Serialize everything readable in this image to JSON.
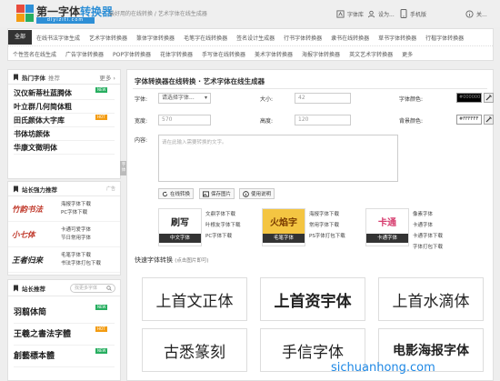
{
  "header": {
    "logo_title_prefix": "第一字体",
    "logo_title_suffix": "转换器",
    "logo_domain": "diyiziti.com",
    "slogan": "最好用的在线转换 / 艺术字体在线生成器",
    "links": [
      {
        "label": "字体库",
        "icon": "font-library-icon"
      },
      {
        "label": "设为...",
        "icon": "user-icon"
      },
      {
        "label": "手机版",
        "icon": "mobile-icon"
      },
      {
        "label": "关...",
        "icon": "info-icon"
      }
    ]
  },
  "nav": {
    "row1": [
      "全部",
      "在线书法字体生成",
      "艺术字体转换器",
      "篆体字体转换器",
      "毛笔字在线转换器",
      "签名设计生成器",
      "行书字体转换器",
      "隶书在线转换器",
      "草书字体转换器",
      "行楷字体转换器"
    ],
    "row2": [
      "个性签名在线生成",
      "广告字体转换器",
      "POP字体转换器",
      "花体字转换器",
      "手写体在线转换器",
      "美术字体转换器",
      "海报字体转换器",
      "英文艺术字转换器",
      "更多"
    ]
  },
  "hot_fonts": {
    "title": "热门字体",
    "subtitle": "推荐",
    "more": "更多",
    "side_tag": "字体",
    "items": [
      {
        "name": "汉仪新蒂杜蓝腾体",
        "badge": "NEW"
      },
      {
        "name": "叶立群几何简体粗",
        "badge": ""
      },
      {
        "name": "田氏颜体大字库",
        "badge": "HOT"
      },
      {
        "name": "书体坊颜体",
        "badge": ""
      },
      {
        "name": "华康文徵明体",
        "badge": ""
      }
    ]
  },
  "strong_rec": {
    "title": "站长强力推荐",
    "tag": "广告",
    "items": [
      {
        "img": "竹韵书法",
        "links": [
          "海报字体下载",
          "PC字体下载"
        ],
        "color": "#c0392b"
      },
      {
        "img": "小七体",
        "links": [
          "卡通可爱字体",
          "节日常用字体"
        ],
        "color": "#c0392b"
      },
      {
        "img": "王者归来",
        "links": [
          "毛笔字体下载",
          "书法字体打包下载"
        ],
        "color": "#222222"
      }
    ]
  },
  "webmaster": {
    "title": "站长推荐",
    "search_placeholder": "找更多字体",
    "items": [
      {
        "name": "羽翦体简",
        "badge": "NEW"
      },
      {
        "name": "王羲之書法字體",
        "badge": "HOT"
      },
      {
        "name": "創藝標本體",
        "badge": "NEW"
      }
    ]
  },
  "main": {
    "title": "字体转换器在线转换 · 艺术字体在线生成器",
    "font_label": "字体:",
    "font_select": "请选择字体...",
    "size_label": "大小:",
    "size_value": "42",
    "color_label": "字体颜色:",
    "color_value": "#000000",
    "width_label": "宽度:",
    "width_value": "570",
    "height_label": "高度:",
    "height_value": "120",
    "bg_label": "背景颜色:",
    "bg_value": "#FFFFFF",
    "content_label": "内容:",
    "content_placeholder": "请在此输入需要转换的文字。",
    "btn_convert": "在线转换",
    "btn_save": "保存图片",
    "btn_help": "使用说明",
    "accent": "#2e8fd6"
  },
  "banners": [
    {
      "img": "刷写",
      "label": "中文字体",
      "label_color": "#333333",
      "links": [
        "文鼎字体下载",
        "叶根友字体下载"
      ]
    },
    {
      "img": "火焰字",
      "label": "毛笔字体",
      "label_color": "#333333",
      "links": [
        "海报字体下载",
        "常用字体下载"
      ]
    },
    {
      "img": "卡通",
      "label": "卡通字体",
      "label_color": "#333333",
      "links": [
        "像素字体",
        "卡通字体"
      ]
    }
  ],
  "banner_links_extra": [
    [
      "PC字体下载"
    ],
    [
      "PS字体打包下载"
    ],
    [
      "卡通字体下载",
      "字体打包下载"
    ]
  ],
  "quick": {
    "title": "快速字体转换",
    "hint": "(点击图片即可)",
    "items": [
      "上首文正体",
      "上首资宇体",
      "上首水滴体",
      "古悉篆刻",
      "手信字体",
      "电影海报字体"
    ]
  },
  "watermark": "sichuanhong.com"
}
